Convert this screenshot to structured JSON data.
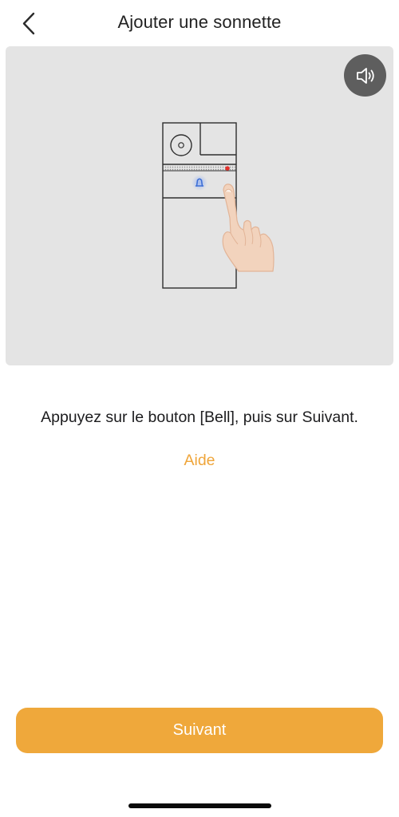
{
  "header": {
    "title": "Ajouter une sonnette",
    "back_icon": "chevron-left-icon"
  },
  "illustration": {
    "speaker_icon": "speaker-icon",
    "device": "doorbell-illustration",
    "hand": "pointing-hand-icon",
    "bell_led_color": "#3d6fd6",
    "indicator_led_color": "#e2302b"
  },
  "main": {
    "instruction": "Appuyez sur le bouton [Bell], puis sur Suivant.",
    "help_label": "Aide"
  },
  "footer": {
    "next_label": "Suivant"
  },
  "colors": {
    "accent": "#efa83b",
    "panel_background": "#e4e4e4",
    "speaker_button": "#5e5e5e"
  }
}
